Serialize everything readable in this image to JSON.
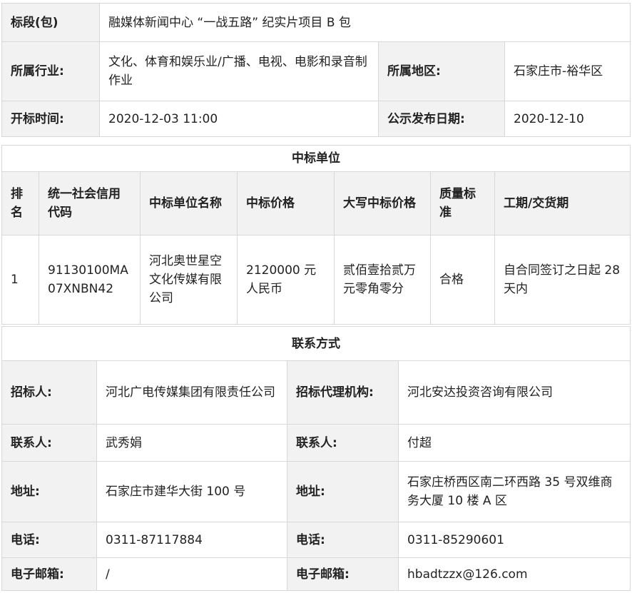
{
  "info": {
    "section_label": "标段(包)",
    "section_value": "融媒体新闻中心 “一战五路” 纪实片项目 B 包",
    "industry_label": "所属行业:",
    "industry_value": "文化、体育和娱乐业/广播、电视、电影和录音制作业",
    "region_label": "所属地区:",
    "region_value": "石家庄市-裕华区",
    "bid_open_label": "开标时间:",
    "bid_open_value": "2020-12-03 11:00",
    "publish_label": "公示发布日期:",
    "publish_value": "2020-12-10"
  },
  "winner": {
    "title": "中标单位",
    "headers": [
      "排名",
      "统一社会信用代码",
      "中标单位名称",
      "中标价格",
      "大写中标价格",
      "质量标准",
      "工期/交货期"
    ],
    "row": [
      "1",
      "91130100MA07XNBN42",
      "河北奥世星空文化传媒有限公司",
      "2120000 元人民币",
      "贰佰壹拾贰万元零角零分",
      "合格",
      "自合同签订之日起 28 天内"
    ]
  },
  "contact": {
    "title": "联系方式",
    "tenderer_label": "招标人:",
    "tenderer_value": "河北广电传媒集团有限责任公司",
    "agency_label": "招标代理机构:",
    "agency_value": "河北安达投资咨询有限公司",
    "contact_label": "联系人:",
    "contact_left": "武秀娟",
    "contact_right": "付超",
    "address_label": "地址:",
    "address_left": "石家庄市建华大街 100 号",
    "address_right": "石家庄桥西区南二环西路 35 号双维商务大厦 10 楼 A 区",
    "phone_label": "电话:",
    "phone_left": "0311-87117884",
    "phone_right": "0311-85290601",
    "email_label": "电子邮箱:",
    "email_left": "/",
    "email_right": "hbadtzzx@126.com"
  }
}
